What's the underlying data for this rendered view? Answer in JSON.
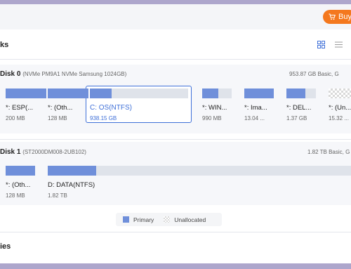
{
  "header": {
    "buy_label": "Buy"
  },
  "section": {
    "title": "ks"
  },
  "disks": [
    {
      "name": "Disk 0",
      "model": "(NVMe PM9A1 NVMe Samsung 1024GB)",
      "summary": "953.87 GB Basic, G",
      "partitions": [
        {
          "label": "*: ESP(...",
          "size": "200 MB",
          "fill": 1.0
        },
        {
          "label": "*: (Oth...",
          "size": "128 MB",
          "fill": 1.0
        },
        {
          "label": "C: OS(NTFS)",
          "size": "938.15 GB",
          "fill": 0.22,
          "selected": true
        },
        {
          "label": "*: WIN...",
          "size": "990 MB",
          "fill": 0.55
        },
        {
          "label": "*: Ima...",
          "size": "13.04 ...",
          "fill": 1.0
        },
        {
          "label": "*: DEL...",
          "size": "1.37 GB",
          "fill": 0.65
        },
        {
          "label": "*: (Un...",
          "size": "15.32 ...",
          "fill": 0,
          "unallocated": true
        }
      ]
    },
    {
      "name": "Disk 1",
      "model": "(ST2000DM008-2UB102)",
      "summary": "1.82 TB Basic, G",
      "partitions": [
        {
          "label": "*: (Oth...",
          "size": "128 MB",
          "fill": 1.0
        },
        {
          "label": "D: DATA(NTFS)",
          "size": "1.82 TB",
          "fill": 0.16
        }
      ]
    }
  ],
  "legend": {
    "primary": "Primary",
    "unallocated": "Unallocated"
  },
  "properties": {
    "title": "ies"
  },
  "colors": {
    "primary": "#6f8fda",
    "accent": "#3e6fd8",
    "buy": "#f4781e"
  }
}
